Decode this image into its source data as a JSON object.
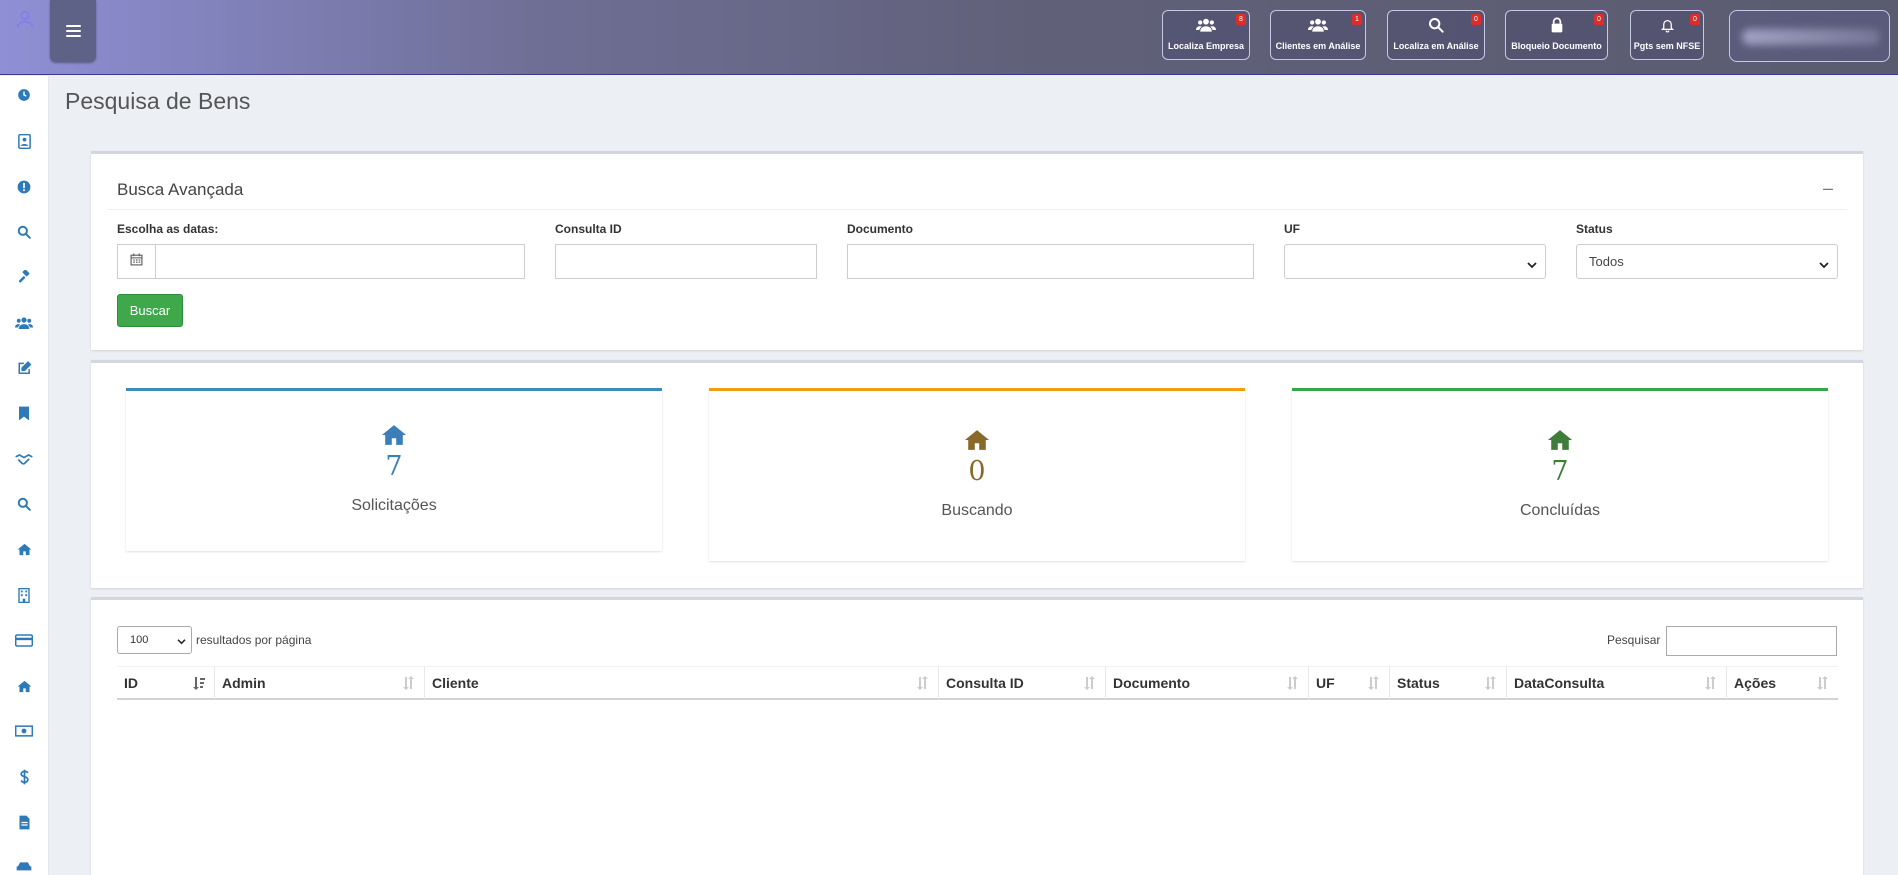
{
  "header": {
    "buttons": [
      {
        "label": "Localiza Empresa",
        "badge": "8",
        "icon": "users-icon"
      },
      {
        "label": "Clientes em Análise",
        "badge": "1",
        "icon": "users-icon"
      },
      {
        "label": "Localiza em Análise",
        "badge": "0",
        "icon": "search-icon"
      },
      {
        "label": "Bloqueio Documento",
        "badge": "0",
        "icon": "lock-icon"
      },
      {
        "label": "Pgts sem NFSE",
        "badge": "0",
        "icon": "bell-icon"
      }
    ]
  },
  "sidebar": {
    "icons": [
      "dashboard-icon",
      "contact-card-icon",
      "alert-icon",
      "search-icon",
      "gavel-icon",
      "users-icon",
      "edit-icon",
      "bookmark-icon",
      "handshake-icon",
      "search-icon",
      "home-icon",
      "building-icon",
      "credit-card-icon",
      "home-icon",
      "money-icon",
      "dollar-icon",
      "document-icon",
      "car-icon"
    ]
  },
  "page": {
    "title": "Pesquisa de Bens"
  },
  "search_box": {
    "title": "Busca Avançada",
    "collapse": "–",
    "fields": {
      "dates_label": "Escolha as datas:",
      "dates_value": "",
      "consulta_label": "Consulta ID",
      "consulta_value": "",
      "documento_label": "Documento",
      "documento_value": "",
      "uf_label": "UF",
      "uf_value": "",
      "status_label": "Status",
      "status_value": "Todos"
    },
    "button": "Buscar"
  },
  "stats": [
    {
      "value": "7",
      "label": "Solicitações",
      "color": "#3c7fb8"
    },
    {
      "value": "0",
      "label": "Buscando",
      "color": "#8a6a2b"
    },
    {
      "value": "7",
      "label": "Concluídas",
      "color": "#3f7e3a"
    }
  ],
  "stat_colors": {
    "blue": "#3c8dbc",
    "orange": "#f39c12",
    "green": "#35a64a"
  },
  "table": {
    "page_length": "100",
    "page_length_label": "resultados por página",
    "search_label": "Pesquisar",
    "search_value": "",
    "columns": [
      "ID",
      "Admin",
      "Cliente",
      "Consulta ID",
      "Documento",
      "UF",
      "Status",
      "DataConsulta",
      "Ações"
    ]
  }
}
